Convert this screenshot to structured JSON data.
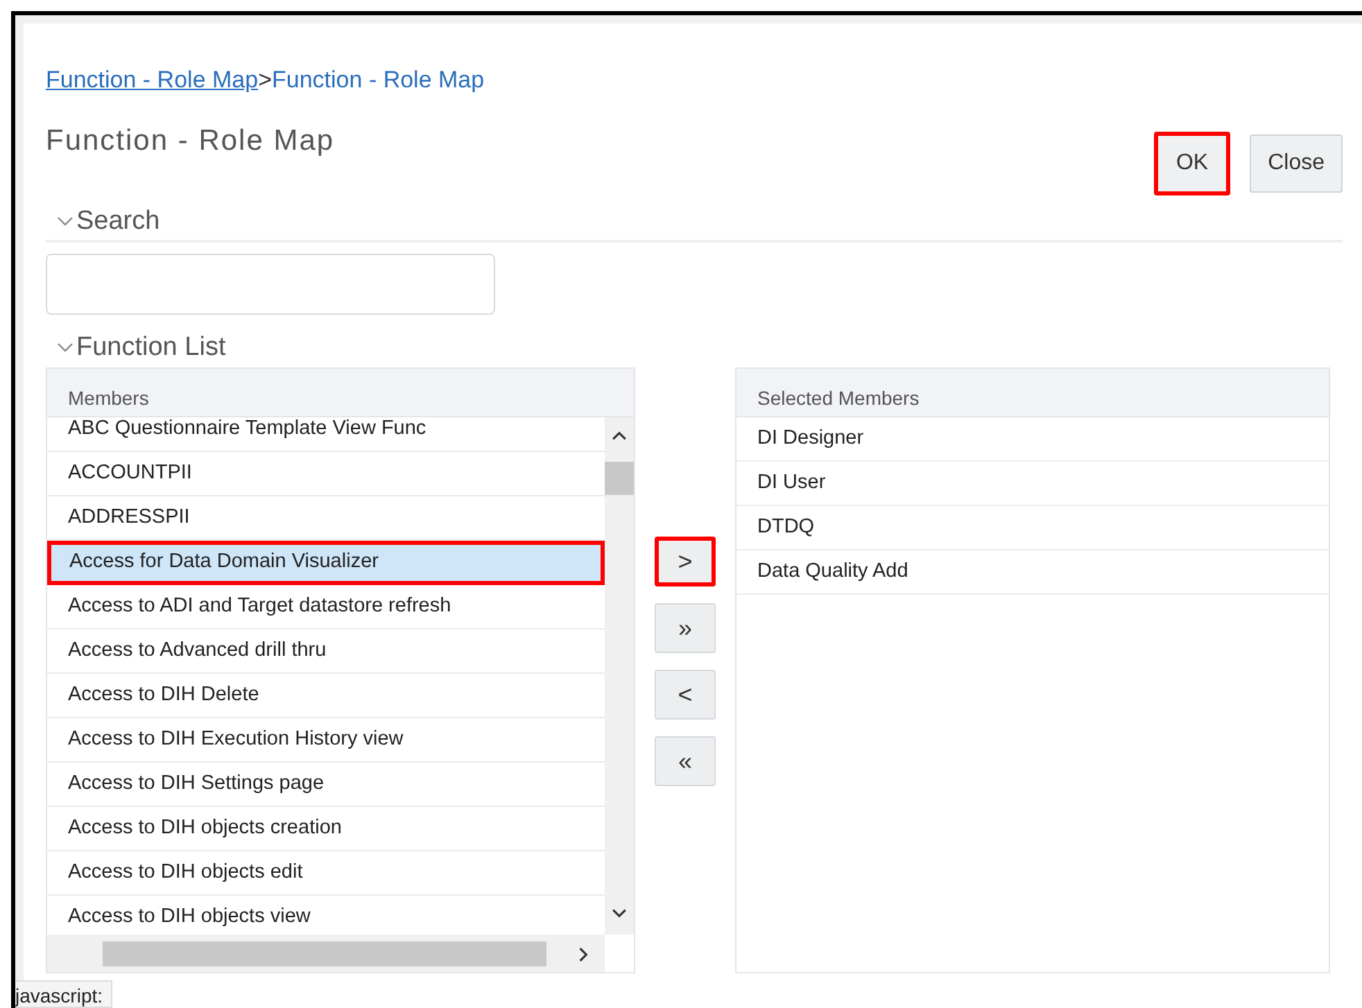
{
  "breadcrumb": [
    {
      "label": "Function - Role Map",
      "kind": "link"
    },
    {
      "label": ">",
      "kind": "separator"
    },
    {
      "label": "Function - Role Map",
      "kind": "current"
    }
  ],
  "title": "Function - Role Map",
  "buttons": [
    {
      "label": "OK",
      "highlighted": true
    },
    {
      "label": "Close",
      "highlighted": false
    }
  ],
  "search_section": {
    "label": "Search",
    "expanded": true
  },
  "function_list": {
    "label": "Function List",
    "expanded": true,
    "members": {
      "header": "Members",
      "rows": [
        {
          "label": "ABC Questionnaire Template View Func",
          "selected": false,
          "highlighted": false
        },
        {
          "label": "ACCOUNTPII",
          "selected": false,
          "highlighted": false
        },
        {
          "label": "ADDRESSPII",
          "selected": false,
          "highlighted": false
        },
        {
          "label": "Access for Data Domain Visualizer",
          "selected": true,
          "highlighted": true
        },
        {
          "label": "Access to ADI and Target datastore refresh",
          "selected": false,
          "highlighted": false
        },
        {
          "label": "Access to Advanced drill thru",
          "selected": false,
          "highlighted": false
        },
        {
          "label": "Access to DIH Delete",
          "selected": false,
          "highlighted": false
        },
        {
          "label": "Access to DIH Execution History view",
          "selected": false,
          "highlighted": false
        },
        {
          "label": "Access to DIH Settings page",
          "selected": false,
          "highlighted": false
        },
        {
          "label": "Access to DIH objects creation",
          "selected": false,
          "highlighted": false
        },
        {
          "label": "Access to DIH objects edit",
          "selected": false,
          "highlighted": false
        },
        {
          "label": "Access to DIH objects view",
          "selected": false,
          "highlighted": false
        }
      ]
    },
    "move_buttons": [
      {
        "label": ">",
        "highlighted": true
      },
      {
        "label": "»",
        "highlighted": false
      },
      {
        "label": "<",
        "highlighted": false
      },
      {
        "label": "«",
        "highlighted": false
      }
    ],
    "selected_members": {
      "header": "Selected Members",
      "rows": [
        {
          "label": "DI Designer"
        },
        {
          "label": "DI User"
        },
        {
          "label": "DTDQ"
        },
        {
          "label": "Data Quality Add"
        }
      ]
    }
  },
  "status_tooltip": "javascript:"
}
